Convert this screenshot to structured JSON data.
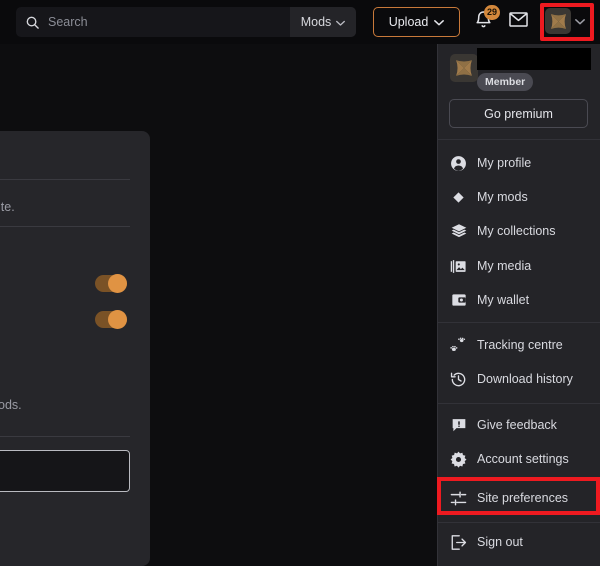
{
  "topbar": {
    "search": {
      "placeholder": "Search",
      "value": "",
      "icon": "search-icon"
    },
    "mods_filter": {
      "label": "Mods",
      "icon": "chevron-down-icon"
    },
    "upload": {
      "label": "Upload",
      "icon": "chevron-down-icon"
    },
    "notifications": {
      "icon": "bell-icon",
      "count": "29"
    },
    "messages": {
      "icon": "mail-icon"
    },
    "avatar": {
      "icon": "user-avatar-pinwheel-icon",
      "chevron": "chevron-down-icon"
    }
  },
  "menu": {
    "username": "",
    "role_badge": "Member",
    "premium_label": "Go premium",
    "groups": [
      {
        "items": [
          {
            "label": "My profile",
            "icon": "person-circle-icon"
          },
          {
            "label": "My mods",
            "icon": "diamond-icon"
          },
          {
            "label": "My collections",
            "icon": "layers-icon"
          },
          {
            "label": "My media",
            "icon": "image-stack-icon"
          },
          {
            "label": "My wallet",
            "icon": "wallet-icon"
          }
        ]
      },
      {
        "items": [
          {
            "label": "Tracking centre",
            "icon": "paw-tracks-icon"
          },
          {
            "label": "Download history",
            "icon": "clock-rewind-icon"
          }
        ]
      },
      {
        "items": [
          {
            "label": "Give feedback",
            "icon": "feedback-alert-icon"
          },
          {
            "label": "Account settings",
            "icon": "gear-icon"
          },
          {
            "label": "Site preferences",
            "icon": "sliders-icon",
            "highlighted": true
          }
        ]
      },
      {
        "items": [
          {
            "label": "Sign out",
            "icon": "sign-out-icon"
          }
        ]
      }
    ]
  },
  "background_panel": {
    "text_fragments": [
      "ite.",
      "ods."
    ],
    "toggles": [
      {
        "state": "on"
      },
      {
        "state": "on"
      }
    ],
    "input": {
      "value": ""
    }
  },
  "colors": {
    "accent_orange": "#d4883c",
    "toggle_on": "#e09343",
    "highlight_red": "#ee1a20",
    "menu_bg": "#242428",
    "topbar_bg": "#0a0a0c",
    "page_bg": "#0d0d0f"
  }
}
